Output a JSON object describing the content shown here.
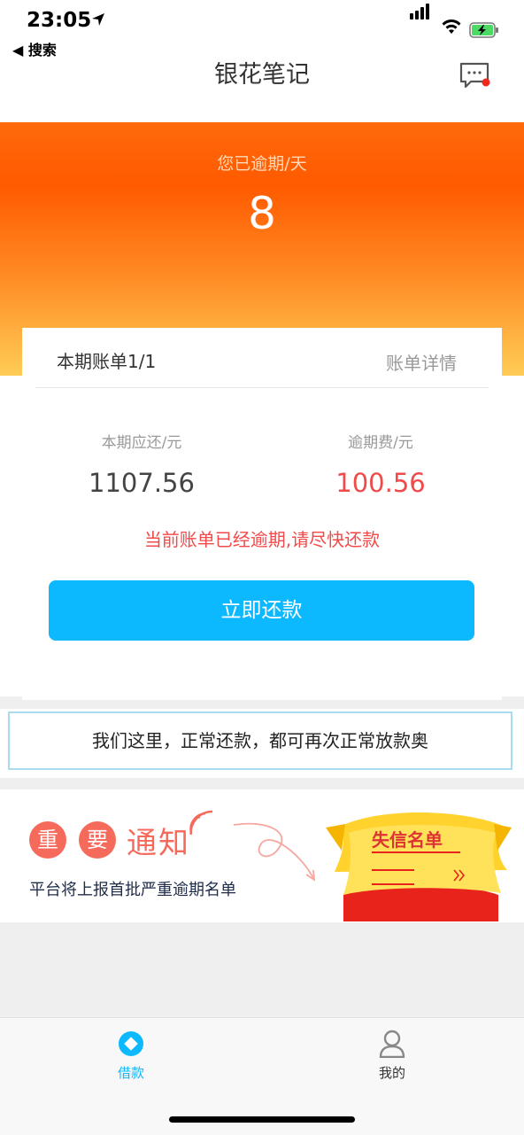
{
  "status_bar": {
    "time": "23:05",
    "back_app": "◀ 搜索"
  },
  "nav": {
    "title": "银花笔记"
  },
  "banner": {
    "overdue_label": "您已逾期/天",
    "overdue_days": "8"
  },
  "bill": {
    "title": "本期账单1/1",
    "detail_link": "账单详情",
    "due_label": "本期应还/元",
    "due_amount": "1107.56",
    "fee_label": "逾期费/元",
    "fee_amount": "100.56",
    "warning": "当前账单已经逾期,请尽快还款",
    "pay_button": "立即还款"
  },
  "notice": {
    "text": "我们这里，正常还款，都可再次正常放款奥"
  },
  "important": {
    "badge_1": "重",
    "badge_2": "要",
    "headline": "通知",
    "subtitle": "平台将上报首批严重逾期名单",
    "scroll_title": "失信名单"
  },
  "tabbar": {
    "loan_label": "借款",
    "mine_label": "我的"
  },
  "colors": {
    "accent": "#0cb9ff",
    "danger": "#f04a4a",
    "banner": "#ff5a00"
  }
}
